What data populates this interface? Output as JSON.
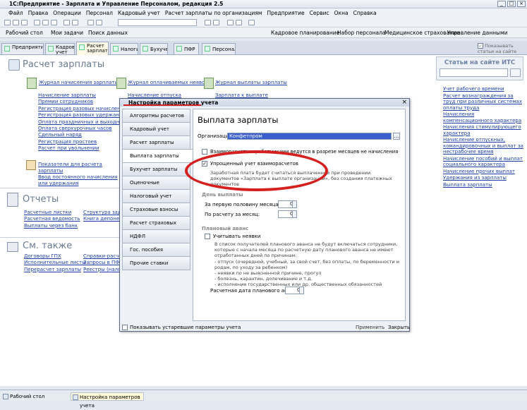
{
  "app": {
    "title": "1С:Предприятие - Зарплата и Управление Персоналом, редакция 2.5"
  },
  "menu": [
    "Файл",
    "Правка",
    "Операции",
    "Персонал",
    "Кадровый учет",
    "Расчет зарплаты по организациям",
    "Предприятие",
    "Сервис",
    "Окна",
    "Справка"
  ],
  "panel": {
    "left": [
      "Рабочий стол",
      "Мои задачи",
      "Поиск данных"
    ],
    "right": [
      "Кадровое планирование",
      "Набор персонала",
      "Медицинское страхование",
      "Управление данными сотрудника"
    ]
  },
  "tabs": [
    "Предприятие",
    "Кадровый учет",
    "Расчет зарплаты",
    "Налоги",
    "Бухучет",
    "ПФР",
    "Персонал"
  ],
  "its_checkbox": "Показывать статьи на сайте ИТС",
  "main": {
    "title": "Расчет зарплаты",
    "journal1": "Журнал начисления зарплаты",
    "journal1_items": [
      "Начисление зарплаты",
      "Премии сотрудников",
      "Регистрация разовых начислений",
      "Регистрация разовых удержаний",
      "Оплата праздничных и выходных",
      "Оплата сверхурочных часов",
      "Сдельный наряд",
      "Регистрация простоев",
      "Расчет при увольнении"
    ],
    "journal2": "Журнал оплачиваемых неявок",
    "journal2_item": "Начисление отпуска",
    "journal3": "Журнал выплаты зарплаты",
    "journal3_item": "Зарплата к выплате",
    "indicators": "Показатели для расчета зарплаты",
    "permanent": "Ввод постоянного начисления или удержания",
    "reports_title": "Отчеты",
    "reports": [
      "Расчетные листки",
      "Расчетная ведомость",
      "Выплаты через банк"
    ],
    "reports2": [
      "Структура задол",
      "Книга депонент"
    ],
    "see_title": "См. также",
    "see": [
      "Договоры ГПХ",
      "Исполнительные листы",
      "Перерасчет зарплаты"
    ],
    "see2": [
      "Справки-расчет",
      "Запросы в ПФР",
      "Реестры (нало"
    ]
  },
  "its": {
    "title": "Статьи на сайте ИТС",
    "links": [
      "Учет рабочего времени",
      "Расчет вознаграждения за труд при различных системах оплаты труда",
      "Начисления компенсационного характера",
      "Начисления стимулирующего характера",
      "Начисление отпускных, командировочных и выплат за нестрабочее время",
      "Начисление пособий и выплат социального характера",
      "Начисление прочих выплат",
      "Удержания из зарплаты",
      "Выплата зарплаты"
    ]
  },
  "dialog": {
    "title": "Настройка параметров учета",
    "tabs": [
      "Алгоритмы расчетов",
      "Кадровый учет",
      "Расчет зарплаты",
      "Выплата зарплаты",
      "Бухучет зарплаты",
      "Оценочные обязательства",
      "Налоговый учет",
      "Страховые взносы",
      "Расчет страховых взносов",
      "НДФЛ",
      "Гос. пособия",
      "Прочие ставки"
    ],
    "heading": "Выплата зарплаты",
    "org_label": "Организация:",
    "org_value": "Конфетпром",
    "detail_check": "Взаиморасчеты с работниками ведутся в разрезе месяцев не начисления",
    "simplified_check": "Упрощенный учет взаиморасчетов",
    "simplified_note": "Заработная плата будет считаться выплаченной при проведении документов «Зарплата к выплате организаций», без создания платежных документов",
    "payday_title": "День выплаты",
    "first_half": "За первую половину месяца:",
    "first_half_value": "0",
    "monthly": "По расчету за месяц:",
    "monthly_value": "0",
    "advance_title": "Плановый аванс",
    "advance_check": "Учитывать неявки",
    "advance_note": "В список получателей планового аванса не будут включаться сотрудники, которые с начала месяца по расчетную дату планового аванса не имеют отработанных дней по причинам:",
    "reasons": [
      "- отпуск (очередной, учебный, за свой счет, без оплаты, по беременности и родам, по уходу за ребенком)",
      "- неявки по не выясненной причине, прогул",
      "- болезнь, карантин, долечивание и т.д.",
      "- исполнение государственных или др. общественных обязанностей"
    ],
    "advance_date": "Расчетная дата планового аванса:",
    "advance_date_value": "0",
    "show_old": "Показывать устаревшие параметры учета",
    "apply": "Применить",
    "close": "Закрыть"
  },
  "statusbar": [
    "Рабочий стол",
    "Настройка параметров учета"
  ]
}
